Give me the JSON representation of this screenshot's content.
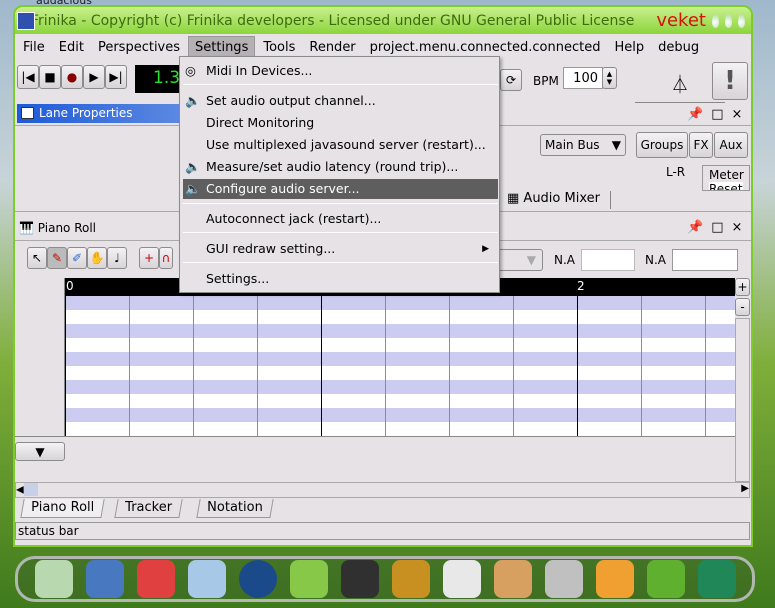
{
  "desktop": {
    "top_text": "audacious"
  },
  "window": {
    "title": "Frinika - Copyright (c) Frinika developers - Licensed under GNU General Public License",
    "brand": "veket"
  },
  "menubar": [
    "File",
    "Edit",
    "Perspectives",
    "Settings",
    "Tools",
    "Render",
    "project.menu.connected.connected",
    "Help",
    "debug"
  ],
  "settings_menu": {
    "items": [
      {
        "label": "Midi In Devices...",
        "icon": "midi-port-icon"
      },
      {
        "label": "Set audio output channel...",
        "icon": "speaker-icon"
      },
      {
        "label": "Direct Monitoring"
      },
      {
        "label": "Use multiplexed javasound server (restart)..."
      },
      {
        "label": "Measure/set audio latency (round trip)...",
        "icon": "speaker-icon"
      },
      {
        "label": "Configure audio server...",
        "icon": "speaker-icon",
        "highlighted": true
      },
      {
        "label": "Autoconnect jack (restart)..."
      },
      {
        "label": "GUI redraw setting...",
        "submenu": true
      },
      {
        "label": "Settings..."
      }
    ]
  },
  "transport": {
    "time": "1.3",
    "bpm_label": "BPM",
    "bpm": "100"
  },
  "lane_properties": {
    "title": "Lane Properties"
  },
  "mixer": {
    "bus": "Main Bus",
    "groups": "Groups",
    "fx": "FX",
    "aux": "Aux",
    "lr": "L-R",
    "meter": "Meter",
    "reset": "Reset",
    "tab": "Audio Mixer"
  },
  "piano_roll": {
    "title": "Piano Roll",
    "na1": "N.A",
    "na2": "N.A",
    "ruler": [
      "0",
      "2"
    ],
    "plus": "+",
    "minus": "-"
  },
  "tabs": [
    "Piano Roll",
    "Tracker",
    "Notation"
  ],
  "status": "status bar",
  "colors": {
    "title_bar": "#8cd43c",
    "lane_header": "#3a6ee0",
    "grid_lavender": "#ccccf0",
    "menu_highlight": "#5e5e5e"
  }
}
